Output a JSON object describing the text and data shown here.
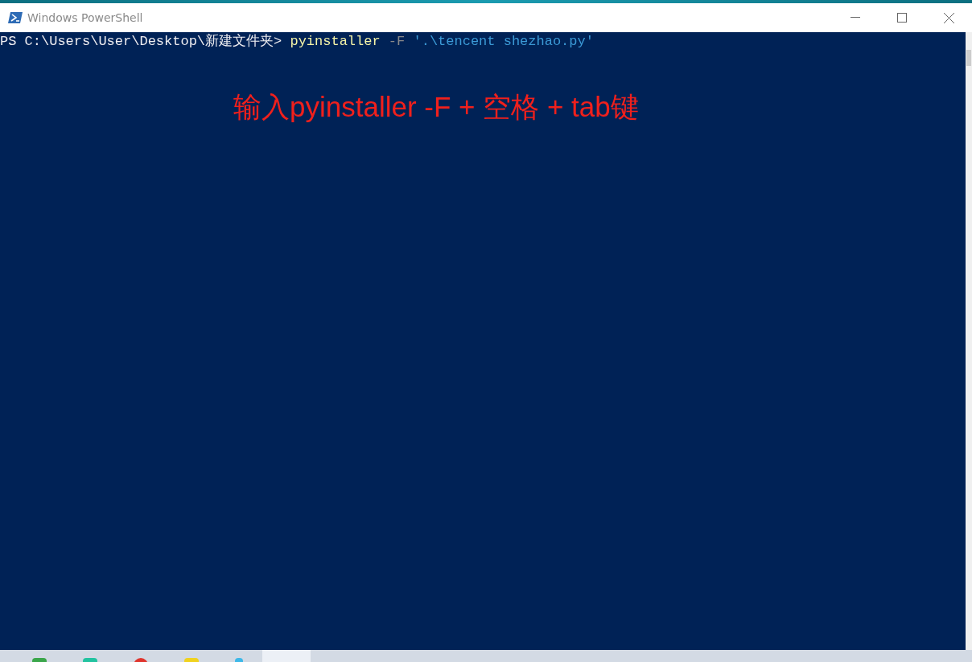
{
  "window": {
    "title": "Windows PowerShell"
  },
  "console": {
    "lines": [
      {
        "segments": [
          {
            "kind": "prompt",
            "text": "PS C:\\Users\\User\\Desktop\\新建文件夹>"
          },
          {
            "kind": "command",
            "text": "pyinstaller"
          },
          {
            "kind": "parameter",
            "text": "-F"
          },
          {
            "kind": "string",
            "text": "'.\\tencent shezhao.py'"
          }
        ]
      }
    ]
  },
  "annotation": {
    "text": "输入pyinstaller -F + 空格 + tab键"
  }
}
